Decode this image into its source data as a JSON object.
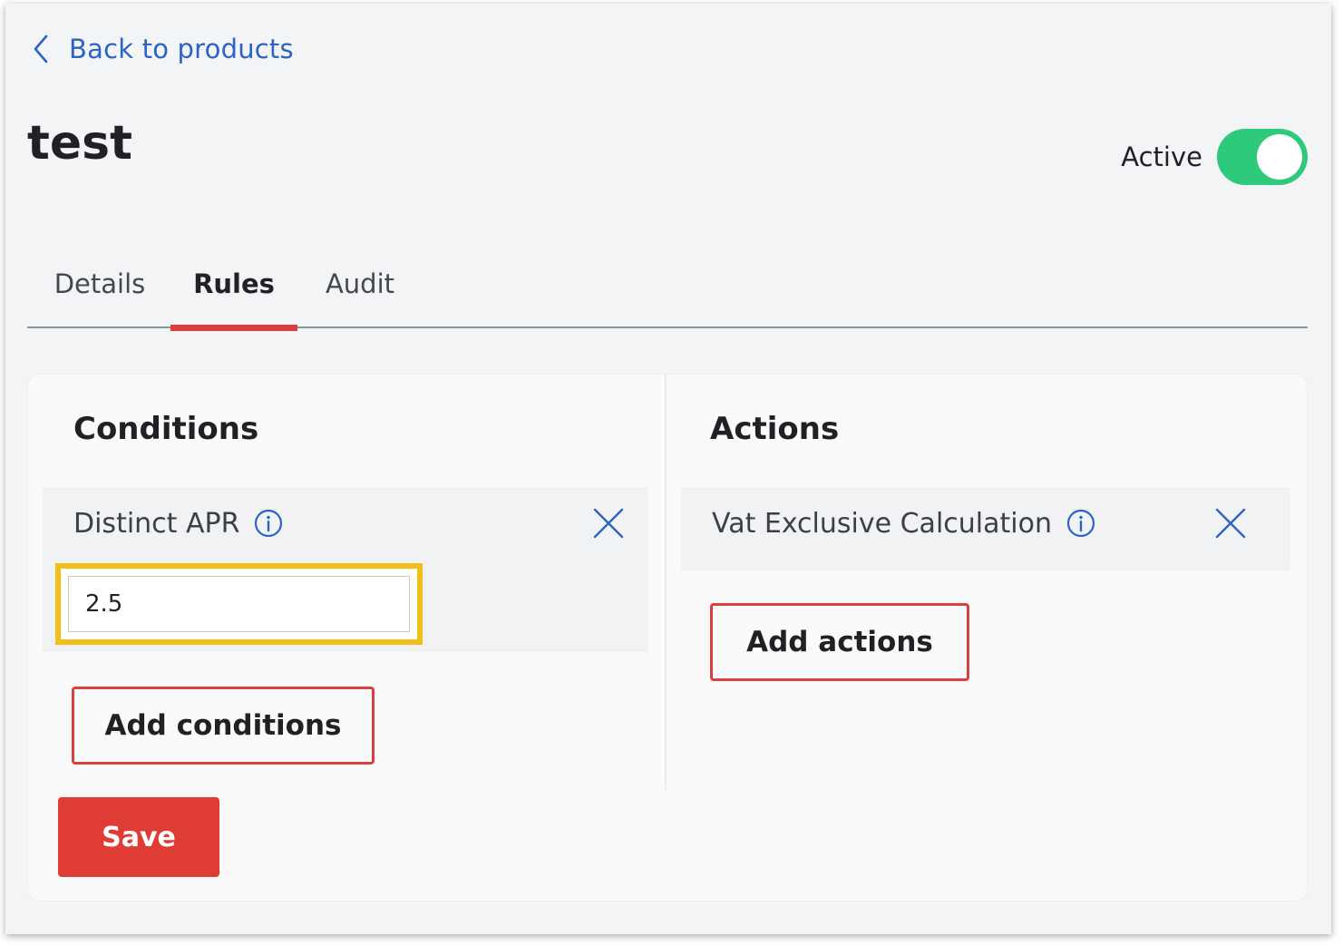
{
  "nav": {
    "back_label": "Back to products"
  },
  "product": {
    "title": "test",
    "status_label": "Active",
    "active": true
  },
  "tabs": [
    {
      "label": "Details",
      "active": false
    },
    {
      "label": "Rules",
      "active": true
    },
    {
      "label": "Audit",
      "active": false
    }
  ],
  "conditions": {
    "title": "Conditions",
    "items": [
      {
        "label": "Distinct APR",
        "value": "2.5"
      }
    ],
    "add_label": "Add conditions"
  },
  "actions": {
    "title": "Actions",
    "items": [
      {
        "label": "Vat Exclusive Calculation"
      }
    ],
    "add_label": "Add actions"
  },
  "save_label": "Save",
  "colors": {
    "link": "#2b64c4",
    "accent_red": "#d9403c",
    "toggle_on": "#2fc97c",
    "highlight": "#f4be1a"
  }
}
